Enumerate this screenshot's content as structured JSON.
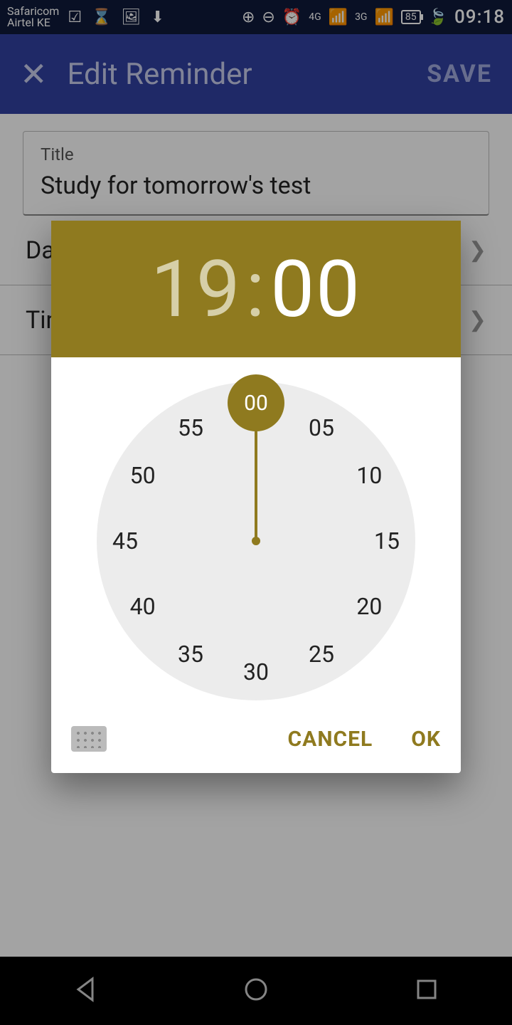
{
  "statusbar": {
    "carrier1": "Safaricom",
    "carrier2": "Airtel KE",
    "battery": "85",
    "time": "09:18",
    "net1": "4G",
    "net2": "3G"
  },
  "appbar": {
    "title": "Edit Reminder",
    "save": "SAVE"
  },
  "form": {
    "title_label": "Title",
    "title_value": "Study for tomorrow's test",
    "date_label": "Date",
    "time_label": "Time"
  },
  "dialog": {
    "hour": "19",
    "minute": "00",
    "cancel": "CANCEL",
    "ok": "OK",
    "ticks": [
      "00",
      "05",
      "10",
      "15",
      "20",
      "25",
      "30",
      "35",
      "40",
      "45",
      "50",
      "55"
    ],
    "selected_tick": "00"
  }
}
